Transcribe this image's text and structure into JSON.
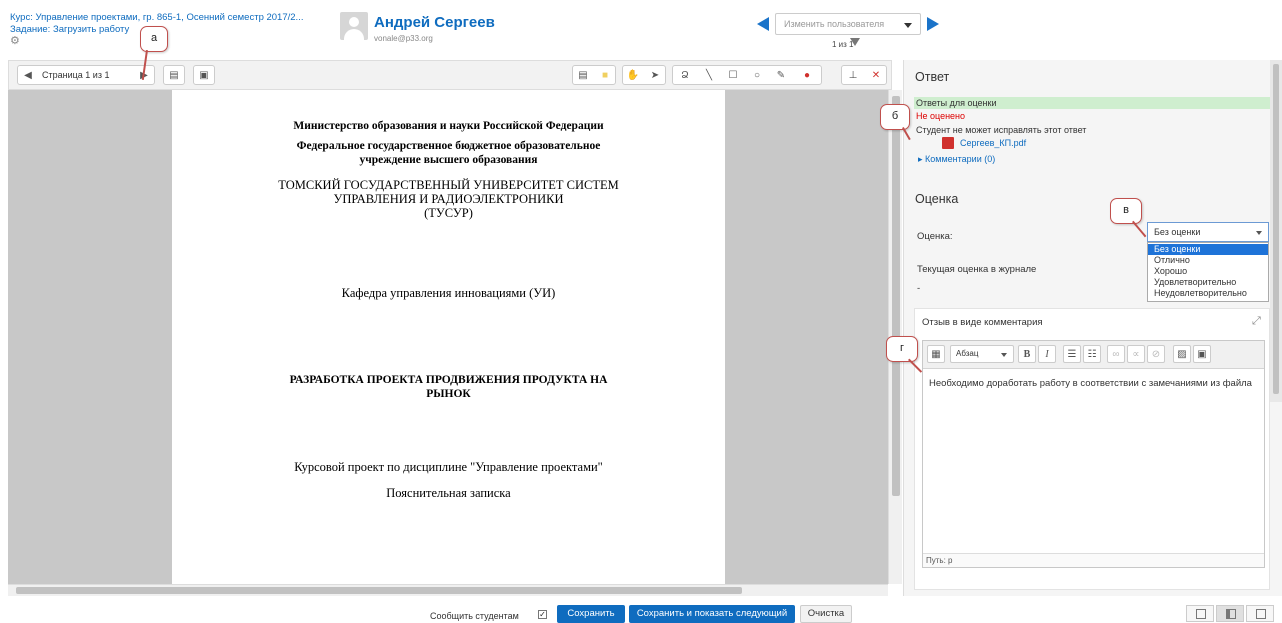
{
  "header": {
    "course": "Курс: Управление проектами, гр. 865-1, Осенний семестр 2017/2...",
    "assignment": "Задание: Загрузить работу",
    "settings_icon": "gear-icon",
    "user": {
      "name": "Андрей Сергеев",
      "email": "vonale@p33.org"
    },
    "user_select_placeholder": "Изменить пользователя",
    "user_count": "1 из 1"
  },
  "callouts": {
    "a": "а",
    "b": "б",
    "v": "в",
    "g": "г"
  },
  "pdf_toolbar": {
    "page_label": "Страница 1 из 1",
    "icons": [
      "prev-page-icon",
      "next-page-icon",
      "search-comments-icon",
      "expand-comments-icon",
      "comment-icon",
      "highlight-icon",
      "pan-icon",
      "select-icon",
      "oval-icon",
      "line-icon",
      "rectangle-icon",
      "circle-icon",
      "pen-icon",
      "color-drop-icon",
      "stamp-icon",
      "delete-icon"
    ]
  },
  "document": {
    "lines": [
      "Министерство образования и науки Российской Федерации",
      "Федеральное государственное бюджетное образовательное",
      "учреждение высшего образования",
      "ТОМСКИЙ ГОСУДАРСТВЕННЫЙ УНИВЕРСИТЕТ СИСТЕМ",
      "УПРАВЛЕНИЯ И РАДИОЭЛЕКТРОНИКИ",
      "(ТУСУР)",
      "Кафедра управления инновациями (УИ)",
      "РАЗРАБОТКА ПРОЕКТА ПРОДВИЖЕНИЯ ПРОДУКТА НА",
      "РЫНОК",
      "Курсовой проект по дисциплине \"Управление проектами\"",
      "Пояснительная записка"
    ]
  },
  "response": {
    "title": "Ответ",
    "band": "Ответы для оценки",
    "status": "Не оценено",
    "note": "Студент не может исправлять этот ответ",
    "file": "Сергеев_КП.pdf",
    "comments": "Комментарии (0)"
  },
  "grade": {
    "title": "Оценка",
    "label": "Оценка:",
    "selected": "Без оценки",
    "options": [
      "Без оценки",
      "Отлично",
      "Хорошо",
      "Удовлетворительно",
      "Неудовлетворительно"
    ],
    "current_label": "Текущая оценка в журнале",
    "current_value": "-"
  },
  "feedback": {
    "title": "Отзыв в виде комментария",
    "format": "Абзац",
    "text": "Необходимо доработать работу в соответствии с замечаниями из файла",
    "path": "Путь: p"
  },
  "footer": {
    "notify_label": "Сообщить студентам",
    "notify_checked": true,
    "save": "Сохранить",
    "save_next": "Сохранить и показать следующий",
    "clear": "Очистка"
  },
  "colors": {
    "link": "#0f6cbf",
    "primary_button": "#0f6cbf",
    "status_error": "#dd0000",
    "band": "#cfeecf",
    "callout_border": "#c0504d"
  }
}
